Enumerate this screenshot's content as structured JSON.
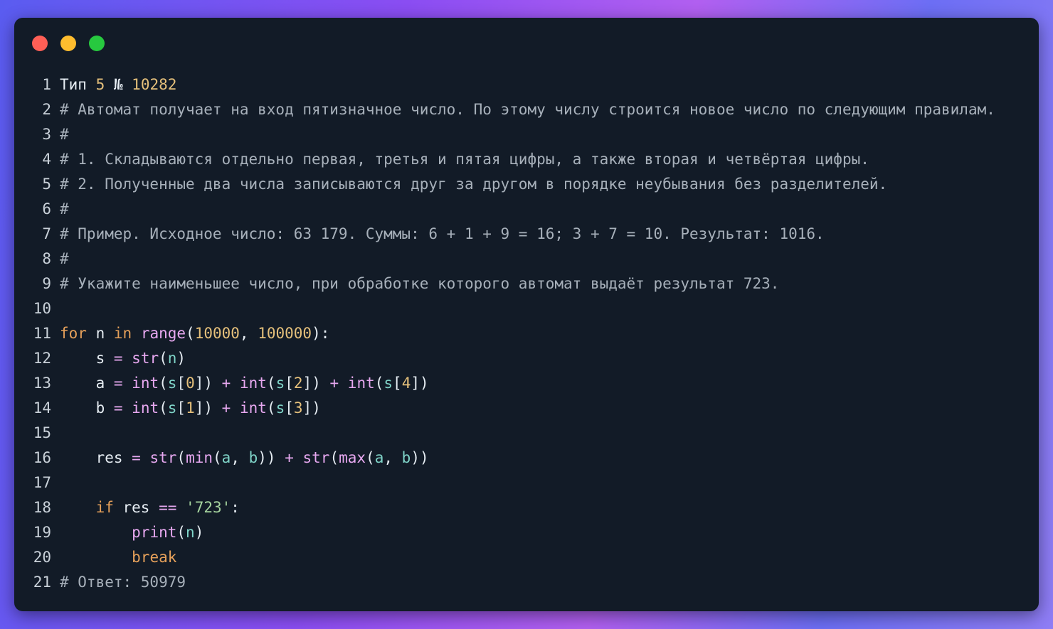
{
  "window": {
    "traffic_colors": [
      "#ff5f56",
      "#ffbd2e",
      "#27c93f"
    ]
  },
  "code_lines": [
    {
      "n": "1",
      "tokens": [
        {
          "t": "Тип ",
          "c": "text"
        },
        {
          "t": "5",
          "c": "num"
        },
        {
          "t": " № ",
          "c": "text"
        },
        {
          "t": "10282",
          "c": "num"
        }
      ]
    },
    {
      "n": "2",
      "tokens": [
        {
          "t": "# Автомат получает на вход пятизначное число. По этому числу строится новое число по следующим правилам.",
          "c": "comment"
        }
      ]
    },
    {
      "n": "3",
      "tokens": [
        {
          "t": "#",
          "c": "comment"
        }
      ]
    },
    {
      "n": "4",
      "tokens": [
        {
          "t": "# 1. Складываются отдельно первая, третья и пятая цифры, а также вторая и четвёртая цифры.",
          "c": "comment"
        }
      ]
    },
    {
      "n": "5",
      "tokens": [
        {
          "t": "# 2. Полученные два числа записываются друг за другом в порядке неубывания без разделителей.",
          "c": "comment"
        }
      ]
    },
    {
      "n": "6",
      "tokens": [
        {
          "t": "#",
          "c": "comment"
        }
      ]
    },
    {
      "n": "7",
      "tokens": [
        {
          "t": "# Пример. Исходное число: 63 179. Суммы: 6 + 1 + 9 = 16; 3 + 7 = 10. Результат: 1016.",
          "c": "comment"
        }
      ]
    },
    {
      "n": "8",
      "tokens": [
        {
          "t": "#",
          "c": "comment"
        }
      ]
    },
    {
      "n": "9",
      "tokens": [
        {
          "t": "# Укажите наименьшее число, при обработке которого автомат выдаёт результат 723.",
          "c": "comment"
        }
      ]
    },
    {
      "n": "10",
      "tokens": []
    },
    {
      "n": "11",
      "tokens": [
        {
          "t": "for",
          "c": "kw"
        },
        {
          "t": " n ",
          "c": "text"
        },
        {
          "t": "in",
          "c": "kw"
        },
        {
          "t": " ",
          "c": "text"
        },
        {
          "t": "range",
          "c": "builtin"
        },
        {
          "t": "(",
          "c": "punct"
        },
        {
          "t": "10000",
          "c": "num"
        },
        {
          "t": ", ",
          "c": "punct"
        },
        {
          "t": "100000",
          "c": "num"
        },
        {
          "t": "):",
          "c": "punct"
        }
      ]
    },
    {
      "n": "12",
      "tokens": [
        {
          "t": "    s ",
          "c": "text"
        },
        {
          "t": "=",
          "c": "op"
        },
        {
          "t": " ",
          "c": "text"
        },
        {
          "t": "str",
          "c": "builtin"
        },
        {
          "t": "(",
          "c": "punct"
        },
        {
          "t": "n",
          "c": "param"
        },
        {
          "t": ")",
          "c": "punct"
        }
      ]
    },
    {
      "n": "13",
      "tokens": [
        {
          "t": "    a ",
          "c": "text"
        },
        {
          "t": "=",
          "c": "op"
        },
        {
          "t": " ",
          "c": "text"
        },
        {
          "t": "int",
          "c": "builtin"
        },
        {
          "t": "(",
          "c": "punct"
        },
        {
          "t": "s",
          "c": "param"
        },
        {
          "t": "[",
          "c": "punct"
        },
        {
          "t": "0",
          "c": "num"
        },
        {
          "t": "]) ",
          "c": "punct"
        },
        {
          "t": "+",
          "c": "op"
        },
        {
          "t": " ",
          "c": "text"
        },
        {
          "t": "int",
          "c": "builtin"
        },
        {
          "t": "(",
          "c": "punct"
        },
        {
          "t": "s",
          "c": "param"
        },
        {
          "t": "[",
          "c": "punct"
        },
        {
          "t": "2",
          "c": "num"
        },
        {
          "t": "]) ",
          "c": "punct"
        },
        {
          "t": "+",
          "c": "op"
        },
        {
          "t": " ",
          "c": "text"
        },
        {
          "t": "int",
          "c": "builtin"
        },
        {
          "t": "(",
          "c": "punct"
        },
        {
          "t": "s",
          "c": "param"
        },
        {
          "t": "[",
          "c": "punct"
        },
        {
          "t": "4",
          "c": "num"
        },
        {
          "t": "])",
          "c": "punct"
        }
      ]
    },
    {
      "n": "14",
      "tokens": [
        {
          "t": "    b ",
          "c": "text"
        },
        {
          "t": "=",
          "c": "op"
        },
        {
          "t": " ",
          "c": "text"
        },
        {
          "t": "int",
          "c": "builtin"
        },
        {
          "t": "(",
          "c": "punct"
        },
        {
          "t": "s",
          "c": "param"
        },
        {
          "t": "[",
          "c": "punct"
        },
        {
          "t": "1",
          "c": "num"
        },
        {
          "t": "]) ",
          "c": "punct"
        },
        {
          "t": "+",
          "c": "op"
        },
        {
          "t": " ",
          "c": "text"
        },
        {
          "t": "int",
          "c": "builtin"
        },
        {
          "t": "(",
          "c": "punct"
        },
        {
          "t": "s",
          "c": "param"
        },
        {
          "t": "[",
          "c": "punct"
        },
        {
          "t": "3",
          "c": "num"
        },
        {
          "t": "])",
          "c": "punct"
        }
      ]
    },
    {
      "n": "15",
      "tokens": []
    },
    {
      "n": "16",
      "tokens": [
        {
          "t": "    res ",
          "c": "text"
        },
        {
          "t": "=",
          "c": "op"
        },
        {
          "t": " ",
          "c": "text"
        },
        {
          "t": "str",
          "c": "builtin"
        },
        {
          "t": "(",
          "c": "punct"
        },
        {
          "t": "min",
          "c": "builtin"
        },
        {
          "t": "(",
          "c": "punct"
        },
        {
          "t": "a",
          "c": "param"
        },
        {
          "t": ", ",
          "c": "punct"
        },
        {
          "t": "b",
          "c": "param"
        },
        {
          "t": ")) ",
          "c": "punct"
        },
        {
          "t": "+",
          "c": "op"
        },
        {
          "t": " ",
          "c": "text"
        },
        {
          "t": "str",
          "c": "builtin"
        },
        {
          "t": "(",
          "c": "punct"
        },
        {
          "t": "max",
          "c": "builtin"
        },
        {
          "t": "(",
          "c": "punct"
        },
        {
          "t": "a",
          "c": "param"
        },
        {
          "t": ", ",
          "c": "punct"
        },
        {
          "t": "b",
          "c": "param"
        },
        {
          "t": "))",
          "c": "punct"
        }
      ]
    },
    {
      "n": "17",
      "tokens": []
    },
    {
      "n": "18",
      "tokens": [
        {
          "t": "    ",
          "c": "text"
        },
        {
          "t": "if",
          "c": "kw"
        },
        {
          "t": " res ",
          "c": "text"
        },
        {
          "t": "==",
          "c": "op"
        },
        {
          "t": " ",
          "c": "text"
        },
        {
          "t": "'723'",
          "c": "str"
        },
        {
          "t": ":",
          "c": "punct"
        }
      ]
    },
    {
      "n": "19",
      "tokens": [
        {
          "t": "        ",
          "c": "text"
        },
        {
          "t": "print",
          "c": "builtin"
        },
        {
          "t": "(",
          "c": "punct"
        },
        {
          "t": "n",
          "c": "param"
        },
        {
          "t": ")",
          "c": "punct"
        }
      ]
    },
    {
      "n": "20",
      "tokens": [
        {
          "t": "        ",
          "c": "text"
        },
        {
          "t": "break",
          "c": "kw"
        }
      ]
    },
    {
      "n": "21",
      "tokens": [
        {
          "t": "# Ответ: 50979",
          "c": "comment"
        }
      ]
    }
  ]
}
